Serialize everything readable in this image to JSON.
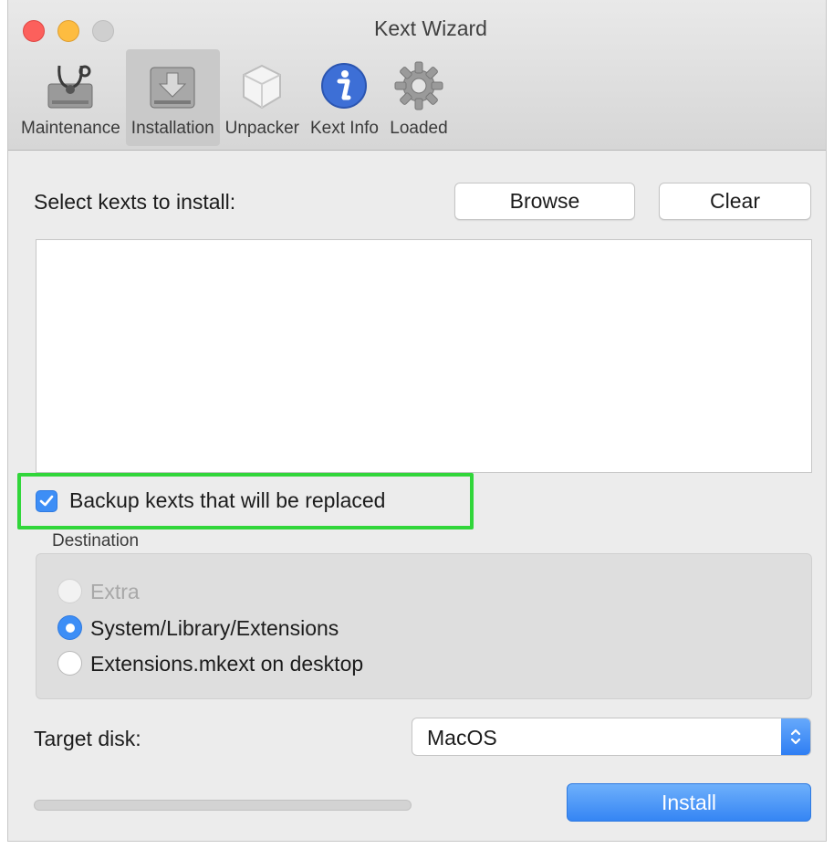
{
  "window": {
    "title": "Kext Wizard"
  },
  "toolbar": {
    "items": [
      {
        "label": "Maintenance",
        "icon": "stethoscope-drive-icon",
        "selected": false
      },
      {
        "label": "Installation",
        "icon": "install-drive-icon",
        "selected": true
      },
      {
        "label": "Unpacker",
        "icon": "unpacker-box-icon",
        "selected": false
      },
      {
        "label": "Kext Info",
        "icon": "info-icon",
        "selected": false
      },
      {
        "label": "Loaded",
        "icon": "gear-icon",
        "selected": false
      }
    ]
  },
  "install": {
    "select_label": "Select kexts to install:",
    "browse_label": "Browse",
    "clear_label": "Clear",
    "backup_label": "Backup kexts that will be replaced",
    "backup_checked": true,
    "destination_label": "Destination",
    "destinations": [
      {
        "label": "Extra",
        "selected": false,
        "enabled": false
      },
      {
        "label": "System/Library/Extensions",
        "selected": true,
        "enabled": true
      },
      {
        "label": "Extensions.mkext on desktop",
        "selected": false,
        "enabled": true
      }
    ],
    "target_disk_label": "Target disk:",
    "target_disk_value": "MacOS",
    "progress": 0,
    "install_label": "Install"
  },
  "colors": {
    "accent": "#3d8ef6",
    "highlight": "#31d63a",
    "close": "#fc605c",
    "minimize": "#fdbc40",
    "zoom": "#cfcfcf"
  }
}
